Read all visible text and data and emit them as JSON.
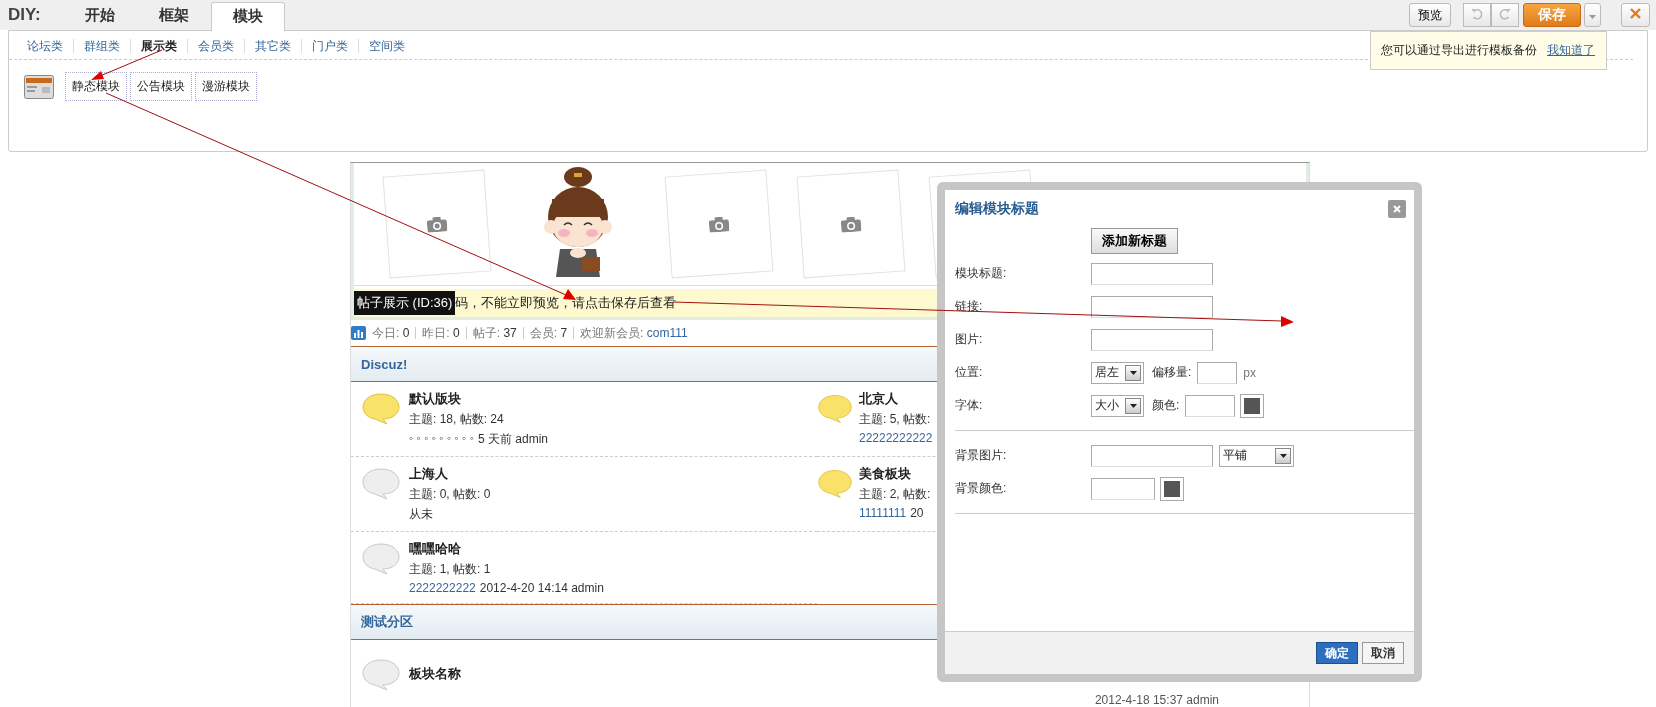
{
  "toolbar": {
    "logo": "DIY:",
    "tabs": [
      {
        "label": "开始",
        "selected": false
      },
      {
        "label": "框架",
        "selected": false
      },
      {
        "label": "模块",
        "selected": true
      }
    ],
    "preview": "预览",
    "save": "保存"
  },
  "panel": {
    "categories": [
      {
        "label": "论坛类",
        "selected": false
      },
      {
        "label": "群组类",
        "selected": false
      },
      {
        "label": "展示类",
        "selected": true
      },
      {
        "label": "会员类",
        "selected": false
      },
      {
        "label": "其它类",
        "selected": false
      },
      {
        "label": "门户类",
        "selected": false
      },
      {
        "label": "空间类",
        "selected": false
      }
    ],
    "modules": [
      "静态模块",
      "公告模块",
      "漫游模块"
    ]
  },
  "tip": {
    "text": "您可以通过导出进行模板备份",
    "link": "我知道了"
  },
  "notice": {
    "label": "帖子展示 (ID:36)",
    "text": "码，不能立即预览，请点击保存后查看"
  },
  "stats": [
    {
      "label": "今日:",
      "value": "0"
    },
    {
      "label": "昨日:",
      "value": "0"
    },
    {
      "label": "帖子:",
      "value": "37"
    },
    {
      "label": "会员:",
      "value": "7"
    },
    {
      "label": "欢迎新会员:",
      "value": "com111",
      "link": true
    }
  ],
  "sections": [
    {
      "title": "Discuz!",
      "kind": "grid",
      "forums": [
        {
          "name": "默认版块",
          "new": true,
          "counts": "主题: 18, 帖数: 24",
          "link": "◦ ◦ ◦ ◦ ◦ ◦ ◦ ◦ ◦",
          "rest": "5 天前 admin",
          "linked": false
        },
        {
          "name": "北京人",
          "new": true,
          "counts": "主题: 5, 帖数:",
          "link": "22222222222",
          "linked": true
        },
        {
          "name": "上海人",
          "new": false,
          "counts": "主题: 0, 帖数: 0",
          "rest": "从未"
        },
        {
          "name": "美食板块",
          "new": true,
          "counts": "主题: 2, 帖数:",
          "link": "11111111",
          "rest": "20",
          "linked": true
        },
        {
          "name": "嘿嘿哈哈",
          "new": false,
          "counts": "主题: 1, 帖数: 1",
          "link": "2222222222",
          "rest": "2012-4-20 14:14 admin",
          "linked": true
        }
      ]
    },
    {
      "title": "测试分区",
      "kind": "table",
      "forums": [
        {
          "name": "板块名称",
          "new": false,
          "rest": "2012-4-18 15:37 admin"
        }
      ]
    }
  ],
  "dialog": {
    "title": "编辑模块标题",
    "add_button": "添加新标题",
    "fields": [
      {
        "kind": "text",
        "label": "模块标题:"
      },
      {
        "kind": "text",
        "label": "链接:"
      },
      {
        "kind": "text",
        "label": "图片:"
      },
      {
        "kind": "position",
        "label": "位置:",
        "select": "居左",
        "offset_label": "偏移量:",
        "unit": "px"
      },
      {
        "kind": "font",
        "label": "字体:",
        "select": "大小",
        "color_label": "颜色:"
      }
    ],
    "background_fields": [
      {
        "kind": "image",
        "label": "背景图片:",
        "select": "平铺"
      },
      {
        "kind": "color",
        "label": "背景颜色:"
      }
    ],
    "buttons": [
      {
        "label": "确定",
        "kind": "primary"
      },
      {
        "label": "取消",
        "kind": "secondary"
      }
    ]
  }
}
